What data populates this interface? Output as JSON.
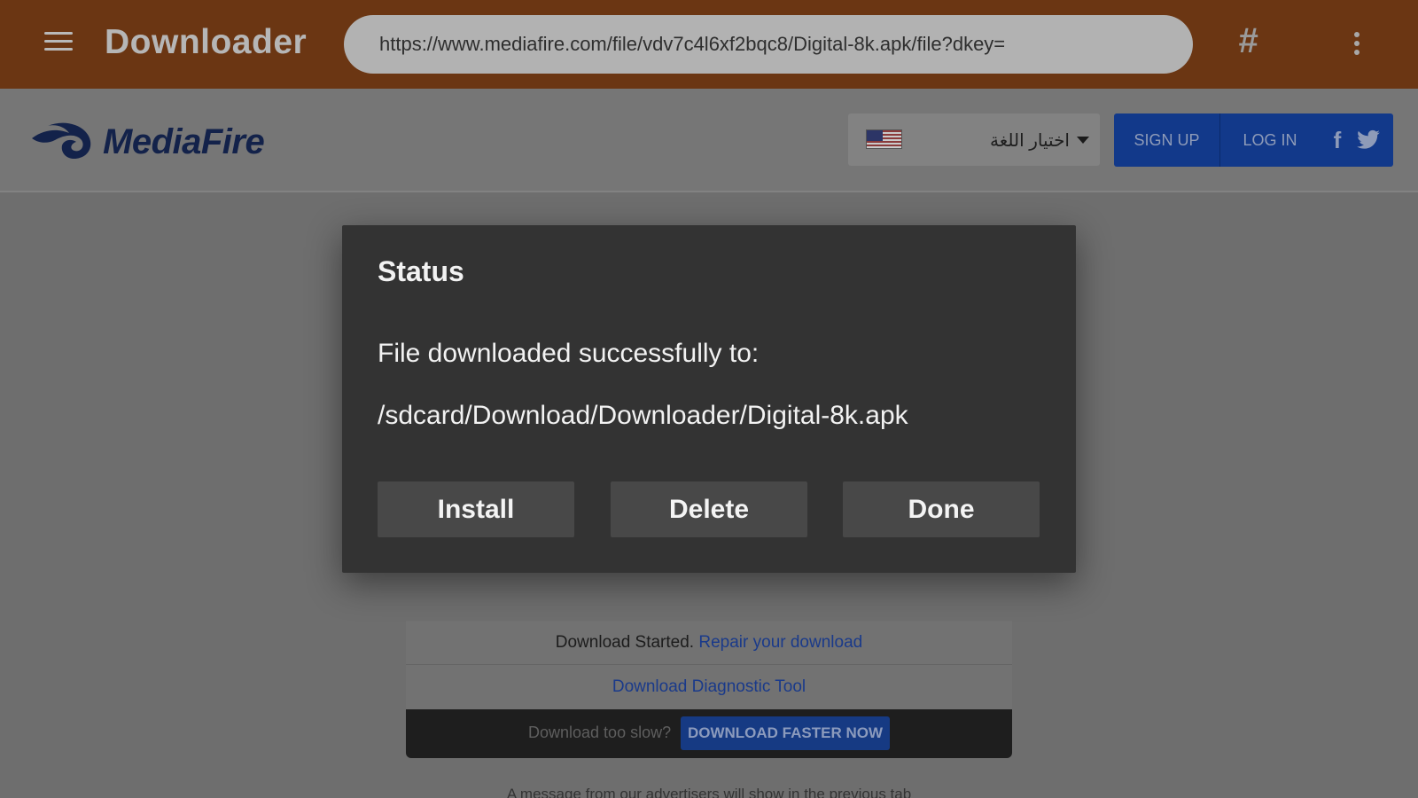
{
  "appbar": {
    "title": "Downloader",
    "url": "https://www.mediafire.com/file/vdv7c4l6xf2bqc8/Digital-8k.apk/file?dkey=",
    "hash_symbol": "#",
    "menu_icon": "hamburger-icon",
    "more_icon": "more-vert-icon"
  },
  "site": {
    "logo_text": "MediaFire",
    "language_label": "اختيار اللغة",
    "signup": "SIGN UP",
    "login": "LOG IN",
    "facebook_glyph": "f"
  },
  "download_panel": {
    "started_text": "Download Started.",
    "repair_link": "Repair your download",
    "diagnostic_link": "Download Diagnostic Tool",
    "slow_text": "Download too slow?",
    "faster_button": "DOWNLOAD FASTER NOW",
    "advert_message": "A message from our advertisers will show in the previous tab"
  },
  "dialog": {
    "title": "Status",
    "message": "File downloaded successfully to:",
    "path": "/sdcard/Download/Downloader/Digital-8k.apk",
    "buttons": {
      "install": "Install",
      "delete": "Delete",
      "done": "Done"
    }
  },
  "colors": {
    "appbar": "#6b3613",
    "dialog_bg": "#333333",
    "dialog_button": "#484848",
    "brand_blue": "#12398a"
  }
}
